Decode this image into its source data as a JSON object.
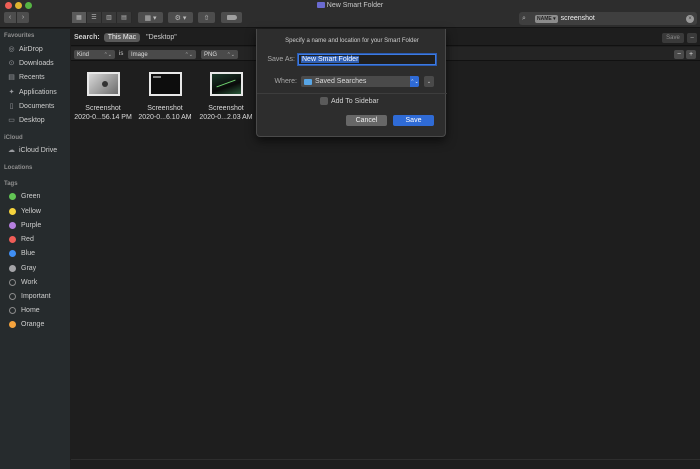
{
  "window": {
    "title": "New Smart Folder"
  },
  "toolbar": {
    "back_glyph": "‹",
    "forward_glyph": "›",
    "view_glyphs": [
      "▦",
      "☰",
      "▥",
      "▤"
    ],
    "group_glyph": "▦ ▾",
    "action_glyph": "⚙ ▾",
    "share_glyph": "⇧",
    "search": {
      "token": "NAME ▾",
      "query": "screenshot",
      "search_glyph": "⌕",
      "clear_glyph": "×"
    }
  },
  "sidebar": {
    "favourites_header": "Favourites",
    "favourites": [
      {
        "label": "AirDrop",
        "icon": "airdrop-icon",
        "glyph": "◎"
      },
      {
        "label": "Downloads",
        "icon": "downloads-icon",
        "glyph": "⊙"
      },
      {
        "label": "Recents",
        "icon": "recents-icon",
        "glyph": "▤"
      },
      {
        "label": "Applications",
        "icon": "applications-icon",
        "glyph": "✦"
      },
      {
        "label": "Documents",
        "icon": "documents-icon",
        "glyph": "▯"
      },
      {
        "label": "Desktop",
        "icon": "desktop-icon",
        "glyph": "▭"
      }
    ],
    "icloud_header": "iCloud",
    "icloud": [
      {
        "label": "iCloud Drive",
        "icon": "cloud-icon",
        "glyph": "☁"
      }
    ],
    "locations_header": "Locations",
    "tags_header": "Tags",
    "tags": [
      {
        "label": "Green",
        "color": "#62c554"
      },
      {
        "label": "Yellow",
        "color": "#f5d33d"
      },
      {
        "label": "Purple",
        "color": "#b67fe0"
      },
      {
        "label": "Red",
        "color": "#f05d57"
      },
      {
        "label": "Blue",
        "color": "#3f8ff5"
      },
      {
        "label": "Gray",
        "color": "#a4a4a8"
      },
      {
        "label": "Work",
        "color": ""
      },
      {
        "label": "Important",
        "color": ""
      },
      {
        "label": "Home",
        "color": ""
      },
      {
        "label": "Orange",
        "color": "#f5a33d"
      }
    ]
  },
  "scope": {
    "label": "Search:",
    "this_mac": "This Mac",
    "desktop": "\"Desktop\"",
    "save_label": "Save",
    "minus": "−"
  },
  "criteria": {
    "attribute": "Kind",
    "operator": "is",
    "value": "Image",
    "format": "PNG",
    "chevron": "⌃⌄",
    "minus": "−",
    "plus": "+"
  },
  "files": [
    {
      "name": "Screenshot",
      "date": "2020-0...56.14 PM"
    },
    {
      "name": "Screenshot",
      "date": "2020-0...6.10 AM"
    },
    {
      "name": "Screenshot",
      "date": "2020-0...2.03 AM"
    }
  ],
  "sheet": {
    "message": "Specify a name and location for your Smart Folder",
    "save_as_label": "Save As:",
    "save_as_value": "New Smart Folder",
    "where_label": "Where:",
    "where_value": "Saved Searches",
    "where_arrows": "⌃⌄",
    "expand_glyph": "⌄",
    "add_to_sidebar": "Add To Sidebar",
    "cancel": "Cancel",
    "save": "Save"
  },
  "colors": {
    "accent": "#2f6bd6",
    "sidebar_bg": "#262b2d",
    "window_bg": "#1e1e1e"
  }
}
